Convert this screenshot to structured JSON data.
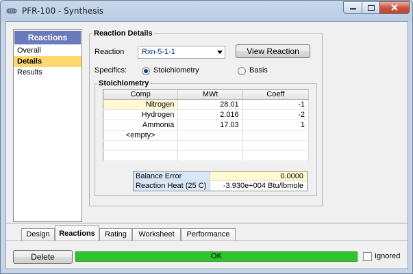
{
  "window": {
    "title": "PFR-100 - Synthesis",
    "icon": "reactor-icon",
    "controls": [
      "minimize-icon",
      "maximize-icon",
      "close-icon"
    ]
  },
  "nav": {
    "header": "Reactions",
    "items": [
      {
        "label": "Overall",
        "active": false
      },
      {
        "label": "Details",
        "active": true
      },
      {
        "label": "Results",
        "active": false
      }
    ]
  },
  "details": {
    "group_title": "Reaction Details",
    "reaction_label": "Reaction",
    "reaction_value": "Rxn-5-1-1",
    "view_button": "View Reaction",
    "specifics_label": "Specifics:",
    "radio_stoich": "Stoichiometry",
    "radio_basis": "Basis",
    "selected_specific": "Stoichiometry"
  },
  "stoich": {
    "title": "Stoichiometry",
    "columns": [
      "Comp",
      "MWt",
      "Coeff"
    ],
    "rows": [
      {
        "comp": "Nitrogen",
        "mwt": "28.01",
        "coeff": "-1"
      },
      {
        "comp": "Hydrogen",
        "mwt": "2.016",
        "coeff": "-2"
      },
      {
        "comp": "Ammonia",
        "mwt": "17.03",
        "coeff": "1"
      },
      {
        "comp": "<empty>",
        "mwt": "",
        "coeff": ""
      }
    ],
    "balance_error_label": "Balance Error",
    "balance_error_value": "0.0000",
    "reaction_heat_label": "Reaction Heat (25 C)",
    "reaction_heat_value": "-3.930e+004 Btu/lbmole"
  },
  "tabs": [
    "Design",
    "Reactions",
    "Rating",
    "Worksheet",
    "Performance"
  ],
  "active_tab": "Reactions",
  "footer": {
    "delete_button": "Delete",
    "status": "OK",
    "ignored_label": "Ignored",
    "ignored_checked": false
  },
  "colors": {
    "nav_header": "#6a7bbd",
    "nav_active": "#ffd970",
    "status_ok": "#2fc42a",
    "select_text": "#003399"
  }
}
